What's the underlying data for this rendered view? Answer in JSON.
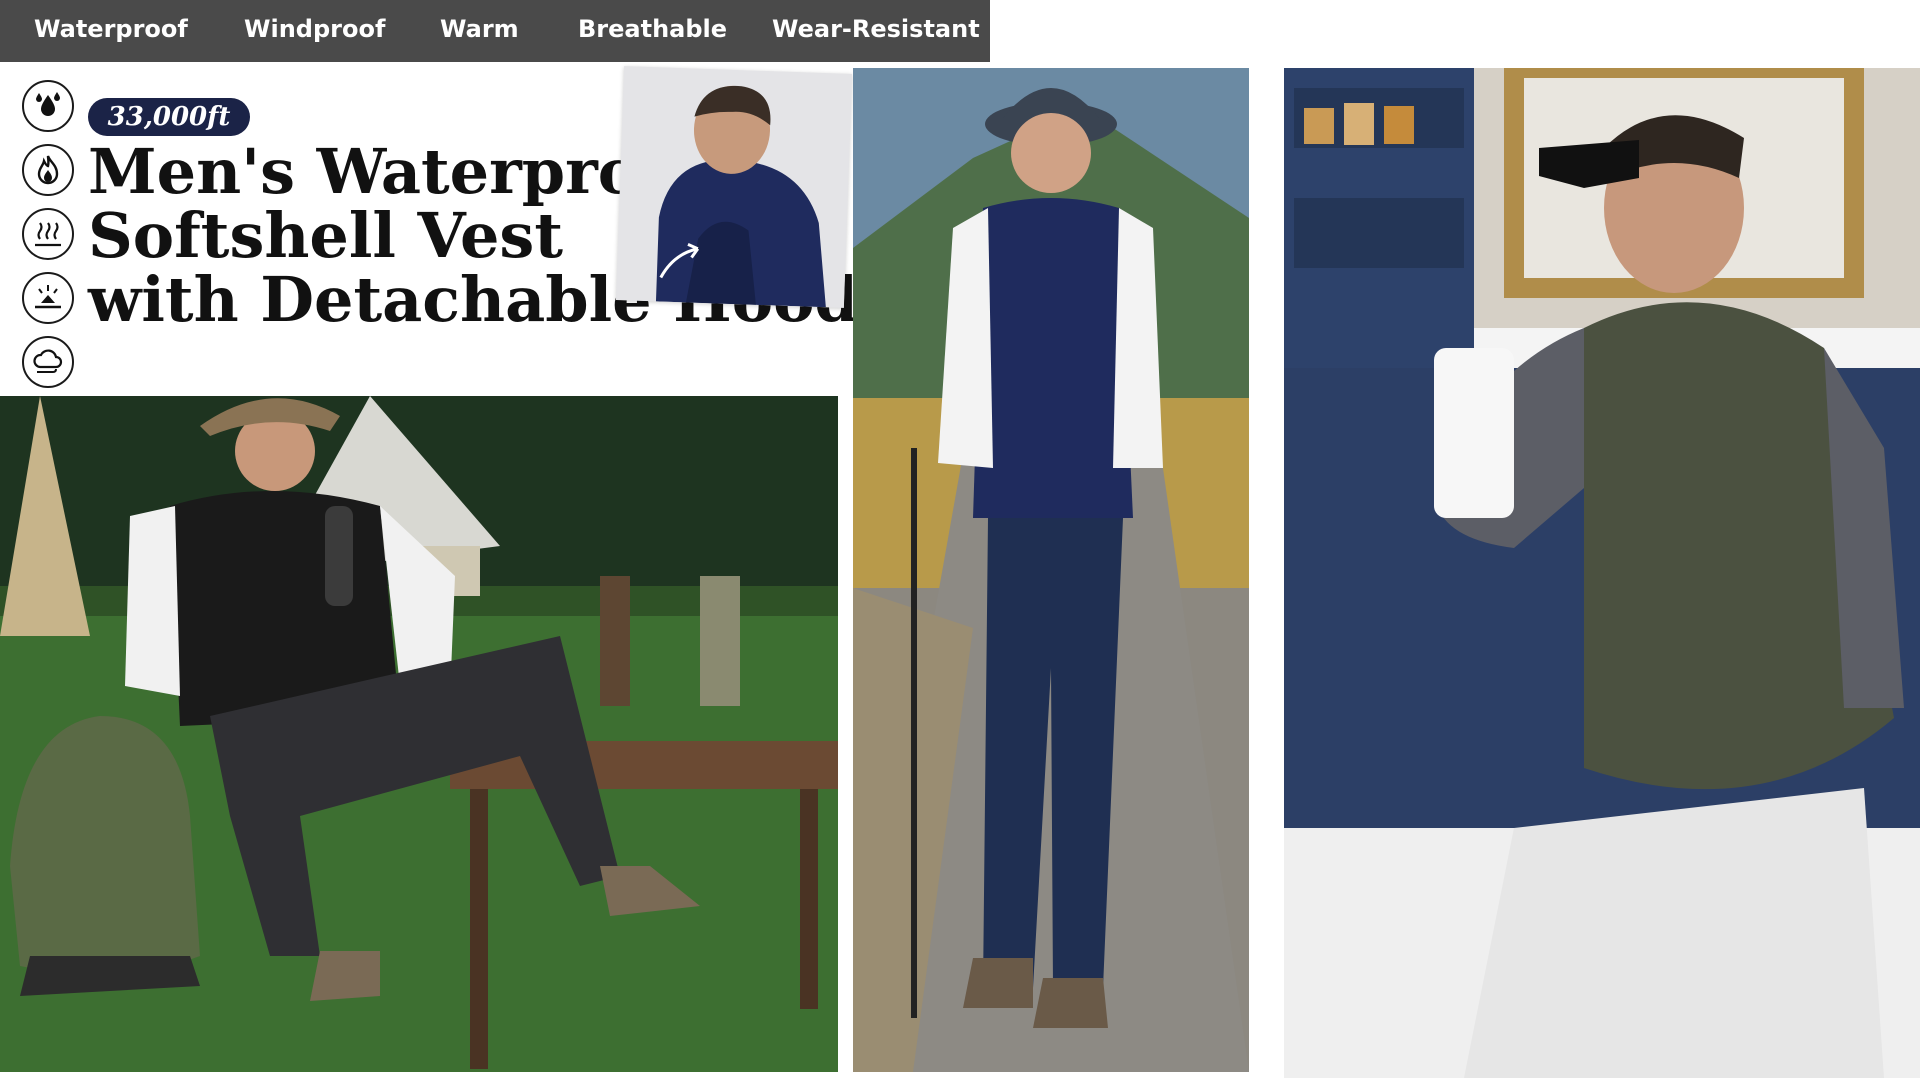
{
  "feature_tabs": [
    "Waterproof",
    "Windproof",
    "Warm",
    "Breathable",
    "Wear-Resistant"
  ],
  "feature_icons": [
    "water-drops-icon",
    "flame-icon",
    "heat-waves-icon",
    "wear-resistant-icon",
    "wind-cloud-icon"
  ],
  "badge": "33,000ft",
  "title_lines": [
    "Men's Waterproof",
    "Softshell Vest",
    "with Detachable Hood"
  ],
  "colors": {
    "tabbar": "#4a4a4a",
    "badge": "#1b2347",
    "navy_vest": "#1f2b5e",
    "black_vest": "#1a1a1a",
    "olive_vest": "#4b5140"
  }
}
